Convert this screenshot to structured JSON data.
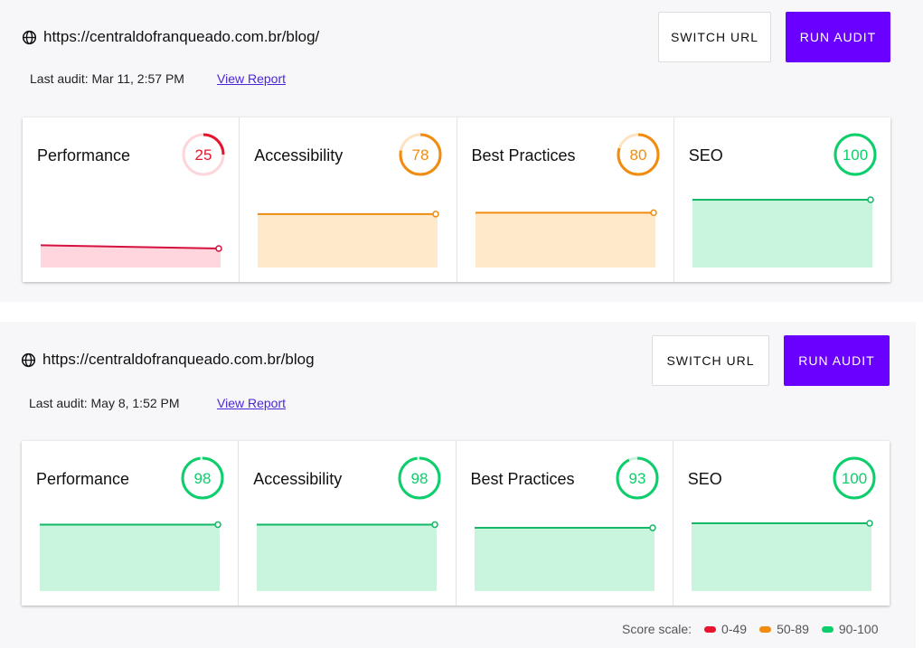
{
  "panels": [
    {
      "url": "https://centraldofranqueado.com.br/blog/",
      "switch_label": "SWITCH URL",
      "run_label": "RUN AUDIT",
      "last_audit": "Last audit: Mar 11, 2:57 PM",
      "view_report": "View Report",
      "cards": [
        {
          "title": "Performance",
          "score": 25,
          "status": "poor",
          "trend": [
            30,
            25
          ]
        },
        {
          "title": "Accessibility",
          "score": 78,
          "status": "average",
          "trend": [
            78,
            78
          ]
        },
        {
          "title": "Best Practices",
          "score": 80,
          "status": "average",
          "trend": [
            80,
            80
          ]
        },
        {
          "title": "SEO",
          "score": 100,
          "status": "good",
          "trend": [
            100,
            100
          ]
        }
      ]
    },
    {
      "url": "https://centraldofranqueado.com.br/blog",
      "switch_label": "SWITCH URL",
      "run_label": "RUN AUDIT",
      "last_audit": "Last audit: May 8, 1:52 PM",
      "view_report": "View Report",
      "cards": [
        {
          "title": "Performance",
          "score": 98,
          "status": "good",
          "trend": [
            98,
            98
          ]
        },
        {
          "title": "Accessibility",
          "score": 98,
          "status": "good",
          "trend": [
            98,
            98
          ]
        },
        {
          "title": "Best Practices",
          "score": 93,
          "status": "good",
          "trend": [
            93,
            93
          ]
        },
        {
          "title": "SEO",
          "score": 100,
          "status": "good",
          "trend": [
            100,
            100
          ]
        }
      ]
    }
  ],
  "legend": {
    "label": "Score scale:",
    "ranges": [
      {
        "label": "0-49",
        "color": "#e8142e"
      },
      {
        "label": "50-89",
        "color": "#f08c10"
      },
      {
        "label": "90-100",
        "color": "#0cce6b"
      }
    ]
  },
  "colors": {
    "poor": {
      "stroke": "#e8142e",
      "track": "#fcd6db",
      "fill": "#ffd6dd",
      "line": "#d4113f"
    },
    "average": {
      "stroke": "#f08c10",
      "track": "#fde3c3",
      "fill": "#ffe9cb",
      "line": "#f08c10"
    },
    "good": {
      "stroke": "#0cce6b",
      "track": "#c9f3dd",
      "fill": "#c9f4de",
      "line": "#12b866"
    },
    "accent": "#6a00ff"
  }
}
